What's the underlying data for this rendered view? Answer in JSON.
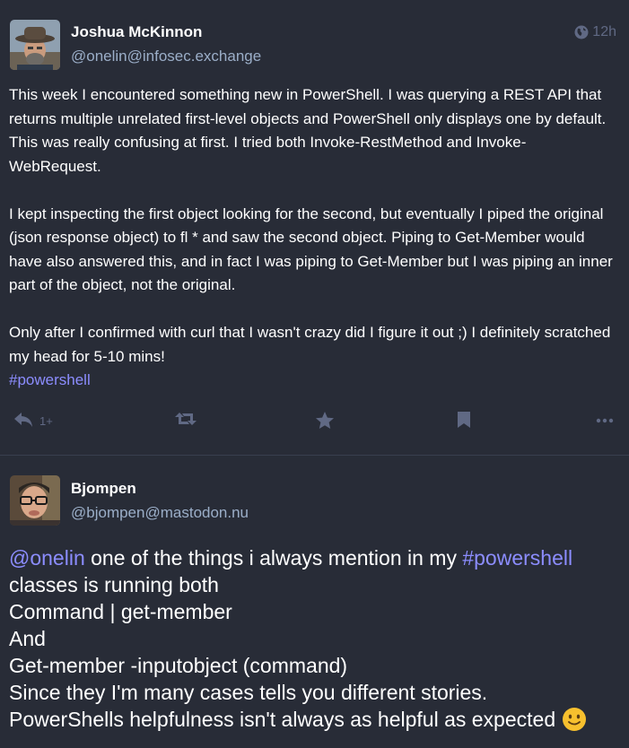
{
  "posts": [
    {
      "author": {
        "display_name": "Joshua McKinnon",
        "handle": "@onelin@infosec.exchange",
        "avatar": "man-with-hat-avatar"
      },
      "visibility_icon": "globe-icon",
      "timestamp": "12h",
      "paragraphs": [
        "This week I encountered something new in PowerShell. I was querying a REST API that returns multiple unrelated first-level objects and PowerShell only displays one by default. This was really confusing at first. I tried both Invoke-RestMethod and Invoke-WebRequest.",
        "I kept inspecting the first object looking for the second, but eventually I piped the original (json response object) to fl * and saw the second object. Piping to Get-Member would have also answered this, and in fact I was piping to Get-Member but I was piping an inner part of the object, not the original.",
        "Only after I confirmed with curl that I wasn't crazy did I figure it out ;) I definitely scratched my head for 5-10 mins!"
      ],
      "hashtag": "#powershell",
      "actions": {
        "reply_icon": "reply-icon",
        "reply_count": "1+",
        "boost_icon": "boost-icon",
        "favourite_icon": "star-icon",
        "bookmark_icon": "bookmark-icon",
        "more_icon": "more-icon"
      }
    },
    {
      "author": {
        "display_name": "Bjompen",
        "handle": "@bjompen@mastodon.nu",
        "avatar": "man-with-glasses-avatar"
      },
      "mention": "@onelin",
      "text_1": " one of the things i always mention in my ",
      "hashtag": "#powershell",
      "lines": [
        "classes is running both",
        "Command | get-member",
        "And",
        "Get-member -inputobject (command)",
        "Since they I'm many cases tells you different stories."
      ],
      "last_line": "PowerShells helpfulness isn't always as helpful as expected",
      "emoji": "slightly-smiling-face"
    }
  ],
  "colors": {
    "background": "#282c37",
    "text": "#ffffff",
    "secondary_text": "#9baec8",
    "muted_icons": "#606984",
    "link": "#8c8dff",
    "divider": "#393f4f"
  }
}
